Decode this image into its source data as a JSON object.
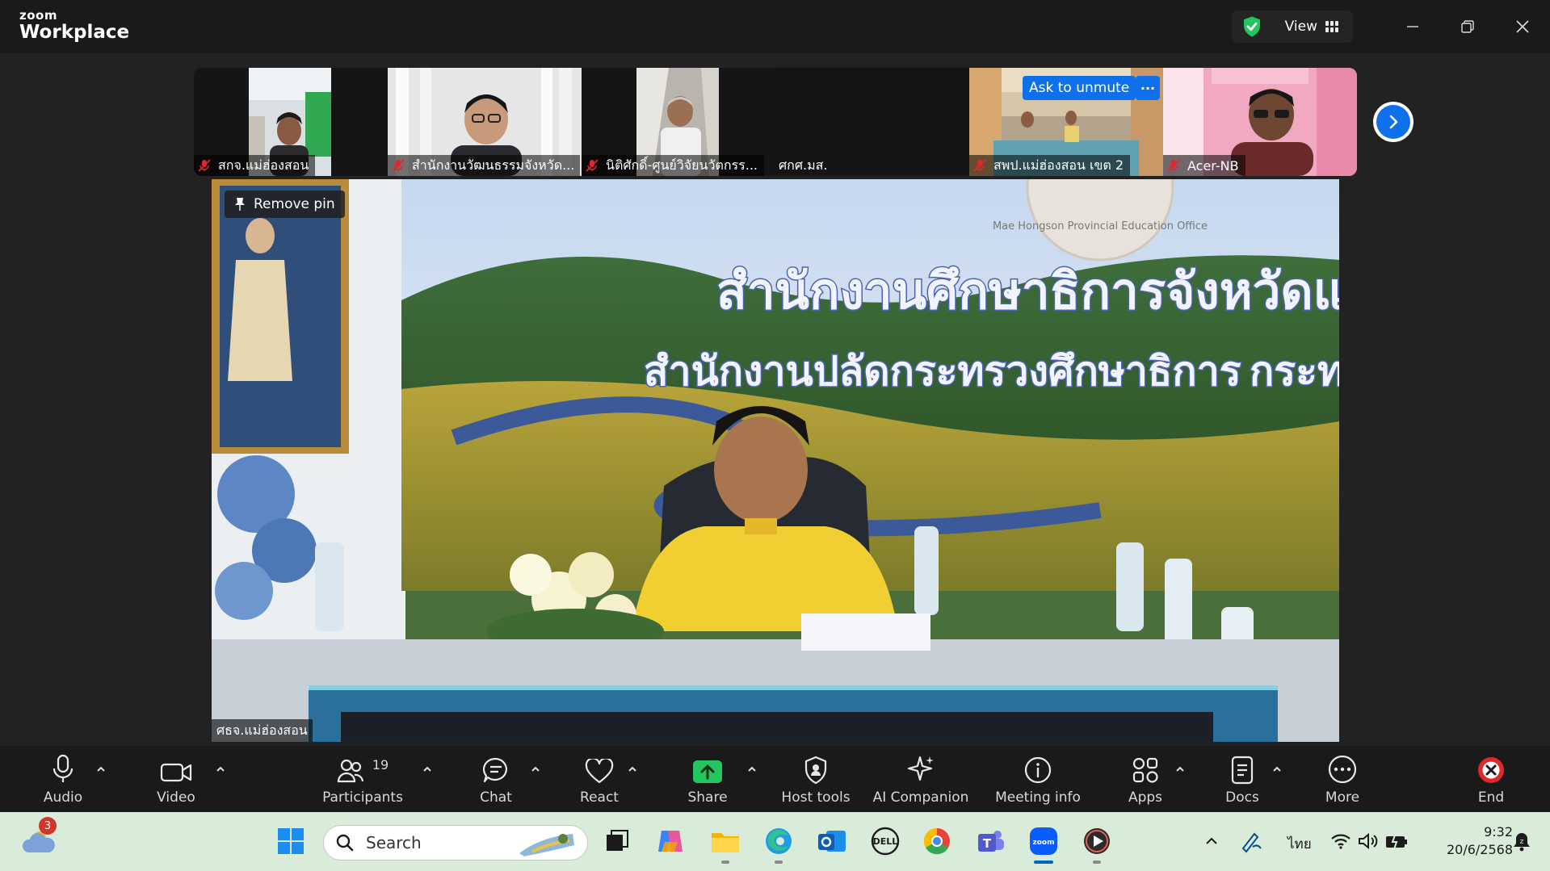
{
  "app": {
    "brand_top": "zoom",
    "brand_bottom": "Workplace",
    "view_label": "View"
  },
  "thumbnails": [
    {
      "name": "สกจ.แม่ฮ่องสอน",
      "muted": true
    },
    {
      "name": "สำนักงานวัฒนธรรมจังหวัด...",
      "muted": true
    },
    {
      "name": "นิติศักดิ์-ศูนย์วิจัยนวัตกรร...",
      "muted": true
    },
    {
      "name": "ศกศ.มส.",
      "muted": false
    },
    {
      "name": "สพป.แม่ฮ่องสอน เขต 2",
      "muted": true,
      "ask_unmute": "Ask to unmute",
      "more": "···"
    },
    {
      "name": "Acer-NB",
      "muted": true
    }
  ],
  "main_video": {
    "remove_pin": "Remove pin",
    "participant": "ศธจ.แม่ฮ่องสอน",
    "banner_line1": "สำนักงานศึกษาธิการจังหวัดแม่ฮ่องสอน",
    "banner_line2": "สำนักงานปลัดกระทรวงศึกษาธิการ",
    "banner_line2b": "กระทรวง",
    "seal_text": "Mae Hongson Provincial Education Office"
  },
  "toolbar": {
    "audio": "Audio",
    "video": "Video",
    "participants": "Participants",
    "participants_count": "19",
    "chat": "Chat",
    "react": "React",
    "share": "Share",
    "host_tools": "Host tools",
    "ai_companion": "AI Companion",
    "meeting_info": "Meeting info",
    "apps": "Apps",
    "docs": "Docs",
    "more": "More",
    "end": "End"
  },
  "taskbar": {
    "weather_badge": "3",
    "search_placeholder": "Search",
    "lang": "ไทย",
    "time": "9:32",
    "date": "20/6/2568"
  },
  "colors": {
    "accent": "#0e71eb",
    "share_green": "#22c55e",
    "end_red": "#e02828",
    "taskbar_bg": "#d8ecd9"
  }
}
